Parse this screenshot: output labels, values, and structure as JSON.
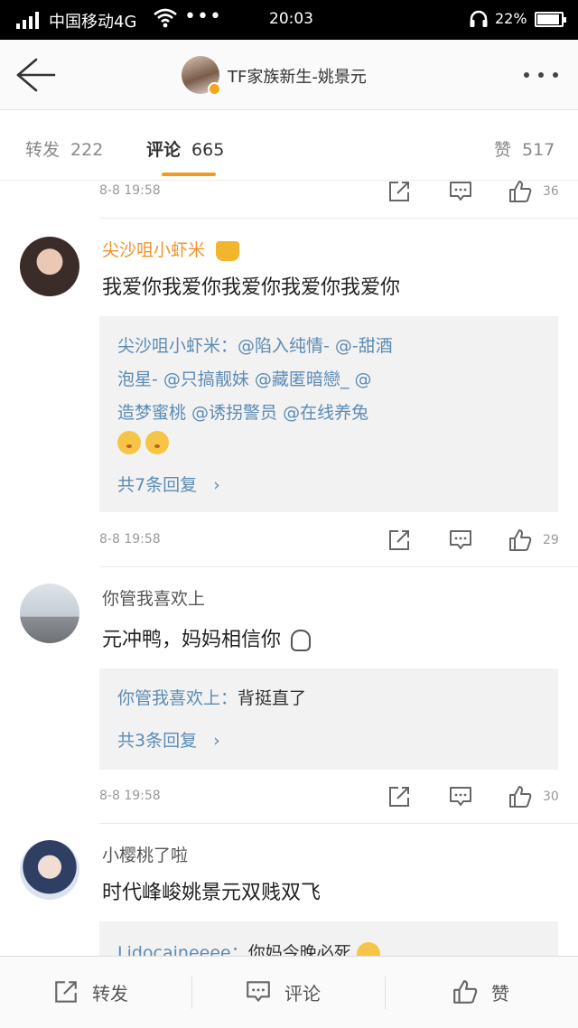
{
  "status_bar": {
    "carrier": "中国移动4G",
    "more": "•••",
    "time": "20:03",
    "battery": "22%"
  },
  "nav": {
    "title": "TF家族新生-姚景元"
  },
  "tabs": [
    {
      "label": "转发",
      "count": "222"
    },
    {
      "label": "评论",
      "count": "665"
    },
    {
      "label": "赞",
      "count": "517"
    }
  ],
  "top_meta": {
    "date": "8-8  19:58",
    "likes": "36"
  },
  "comments": [
    {
      "name": "尖沙咀小虾米",
      "text": "我爱你我爱你我爱你我爱你我爱你",
      "replies": [
        "尖沙咀小虾米：@陷入纯情-   @-甜酒",
        "泡星-   @只搞靓妹   @藏匿暗戀_   @",
        "造梦蜜桃   @诱拐警员   @在线养兔"
      ],
      "more": "共7条回复",
      "date": "8-8  19:58",
      "likes": "29"
    },
    {
      "name": "你管我喜欢上",
      "text": "元冲鸭，妈妈相信你",
      "reply_author": "你管我喜欢上：",
      "reply_text": "背挺直了",
      "more": "共3条回复",
      "date": "8-8  19:58",
      "likes": "30"
    },
    {
      "name": "小樱桃了啦",
      "text": "时代峰峻姚景元双贱双飞",
      "reply_author": "Lidocaineeee：",
      "reply_text": "你妈今晚必死"
    }
  ],
  "bottom_bar": {
    "repost": "转发",
    "comment": "评论",
    "like": "赞"
  },
  "colors": {
    "accent": "#f19a1f",
    "link": "#5b8bb5",
    "name_vip": "#f0922a"
  }
}
